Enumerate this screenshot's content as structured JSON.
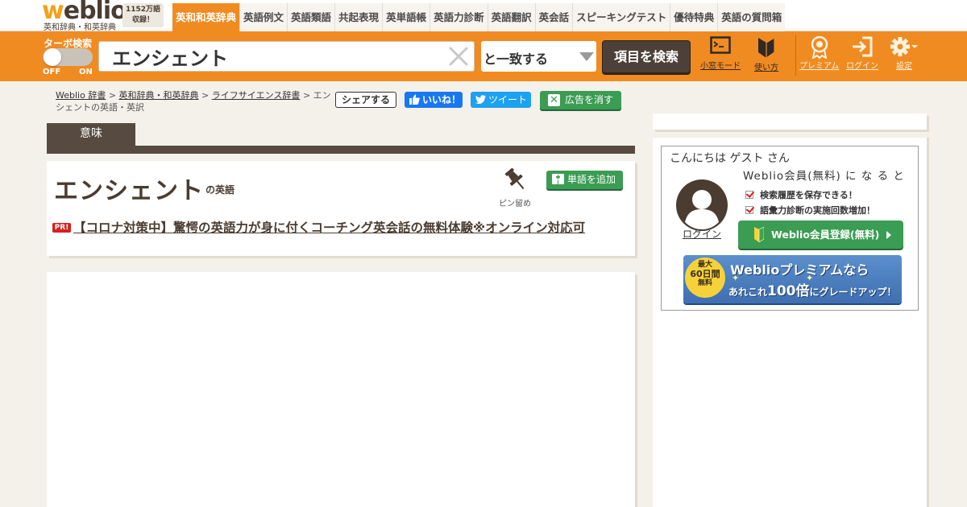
{
  "header": {
    "logo": {
      "first_letter": "w",
      "rest": "eblio",
      "subtitle": "英和辞典・和英辞典"
    },
    "word_count": {
      "line1": "1152万語",
      "line2": "収録！"
    },
    "tabs": [
      {
        "label": "英和和英辞典",
        "active": true
      },
      {
        "label": "英語例文"
      },
      {
        "label": "英語類語"
      },
      {
        "label": "共起表現"
      },
      {
        "label": "英単語帳"
      },
      {
        "label": "英語力診断"
      },
      {
        "label": "英語翻訳"
      },
      {
        "label": "英会話"
      },
      {
        "label": "スピーキングテスト"
      },
      {
        "label": "優待特典"
      },
      {
        "label": "英語の質問箱"
      }
    ]
  },
  "search": {
    "turbo_label": "ターボ検索",
    "turbo_off": "OFF",
    "turbo_on": "ON",
    "turbo_state": "off",
    "query": "エンシェント",
    "match_mode": "と一致する",
    "button_label": "項目を検索"
  },
  "tools": {
    "small_window": "小窓モード",
    "how_to": "使い方",
    "premium": "プレミアム",
    "login": "ログイン",
    "settings": "設定"
  },
  "breadcrumb": {
    "items": [
      "Weblio 辞書",
      "英和辞典・和英辞典",
      "ライフサイエンス辞書"
    ],
    "separator": ">",
    "current": "エンシェントの英語・英訳"
  },
  "social": {
    "share": "シェアする",
    "like": "いいね！",
    "tweet": "ツイート",
    "remove_ads": "広告を消す"
  },
  "main": {
    "tab_label": "意味",
    "entry_word": "エンシェント",
    "entry_suffix": "の英語",
    "pin_label": "ピン留め",
    "add_word": "単語を追加",
    "pr_badge": "PR!",
    "pr_text": "【コロナ対策中】驚愕の英語力が身に付くコーチング英会話の無料体験※オンライン対応可"
  },
  "sidebar": {
    "greeting": "こんにちは ゲスト さん",
    "member_title": "Weblio会員(無料) に な る と",
    "login": "ログイン",
    "benefits": [
      "検索履歴を保存できる！",
      "語彙力診断の実施回数増加！"
    ],
    "register": "Weblio会員登録(無料)",
    "premium": {
      "badge_line1": "最大",
      "badge_line2": "60日間",
      "badge_line3": "無料",
      "line1": "Weblioプレミアムなら",
      "line2_pre": "あれこれ",
      "line2_big": "100倍",
      "line2_post": "にグレードアップ！"
    }
  },
  "colors": {
    "brand_orange": "#f08b21",
    "brand_brown": "#4a3c31",
    "accent_green": "#3b9c53",
    "facebook_blue": "#1877f2",
    "twitter_blue": "#1da1f2"
  }
}
